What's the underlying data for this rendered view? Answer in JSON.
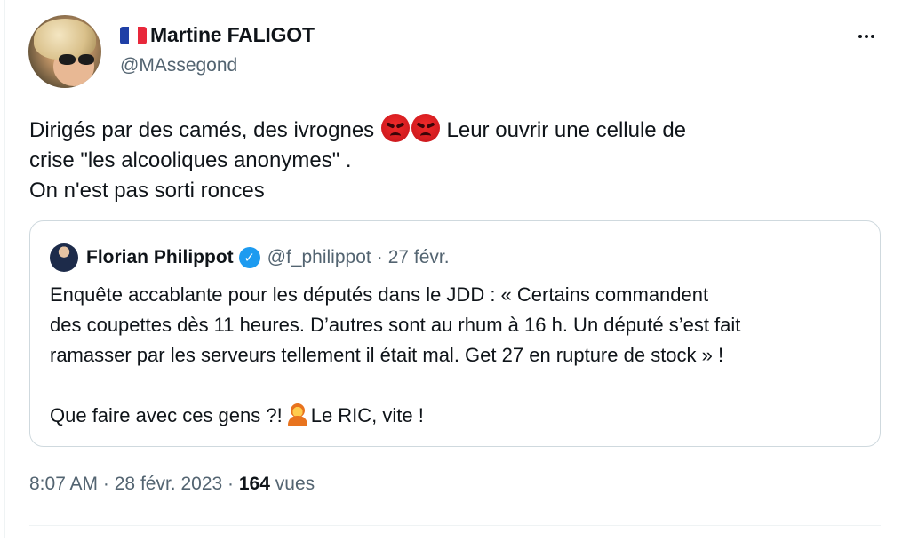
{
  "author": {
    "flag": "french-flag",
    "name": "Martine FALIGOT",
    "handle": "@MAssegond"
  },
  "more_menu": "more-options-icon",
  "tweet": {
    "line1_a": "Dirigés par des camés, des ivrognes",
    "emoji_1": "angry-face-emoji",
    "line1_b": "Leur ouvrir une cellule de",
    "line2": "crise \"les alcooliques anonymes\" .",
    "line3": "On n'est pas sorti ronces"
  },
  "quoted": {
    "name": "Florian Philippot",
    "handle": "@f_philippot",
    "separator": "·",
    "date": "27 févr.",
    "line1": "Enquête accablante pour les députés dans le JDD : « Certains commandent",
    "line2": "des coupettes dès 11 heures. D’autres sont au rhum à 16 h. Un député s’est fait",
    "line3": "ramasser par les serveurs tellement il était mal. Get 27 en rupture de stock » !",
    "line4_a": "Que faire avec ces gens ?!",
    "line4_b": "Le RIC, vite !"
  },
  "meta": {
    "time": "8:07 AM",
    "separator": "·",
    "date": "28 févr. 2023",
    "views_count": "164",
    "views_label": "vues"
  },
  "colors": {
    "text": "#0f1419",
    "secondary": "#536471",
    "border": "#cfd9de",
    "verified": "#1d9bf0"
  }
}
